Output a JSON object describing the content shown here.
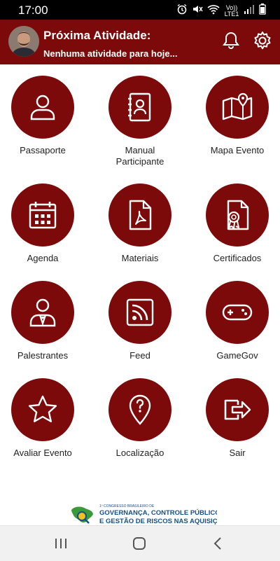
{
  "status": {
    "time": "17:00",
    "network": "Vo)) LTE1"
  },
  "header": {
    "title": "Próxima Atividade:",
    "subtitle": "Nenhuma atividade para hoje..."
  },
  "tiles": [
    {
      "label": "Passaporte",
      "icon": "user-icon"
    },
    {
      "label": "Manual Participante",
      "icon": "contact-book-icon"
    },
    {
      "label": "Mapa Evento",
      "icon": "map-icon"
    },
    {
      "label": "Agenda",
      "icon": "calendar-icon"
    },
    {
      "label": "Materiais",
      "icon": "pdf-icon"
    },
    {
      "label": "Certificados",
      "icon": "certificate-icon"
    },
    {
      "label": "Palestrantes",
      "icon": "speaker-icon"
    },
    {
      "label": "Feed",
      "icon": "rss-icon"
    },
    {
      "label": "GameGov",
      "icon": "gamepad-icon"
    },
    {
      "label": "Avaliar Evento",
      "icon": "star-icon"
    },
    {
      "label": "Localização",
      "icon": "location-icon"
    },
    {
      "label": "Sair",
      "icon": "logout-icon"
    }
  ],
  "footer": {
    "small": "1º CONGRESSO BRASILEIRO DE",
    "line1": "GOVERNANÇA, CONTROLE PÚBLICO",
    "line2": "E GESTÃO DE RISCOS NAS AQUISIÇÕES"
  },
  "colors": {
    "primary": "#7d0a0a",
    "header": "#7d0a0a"
  }
}
